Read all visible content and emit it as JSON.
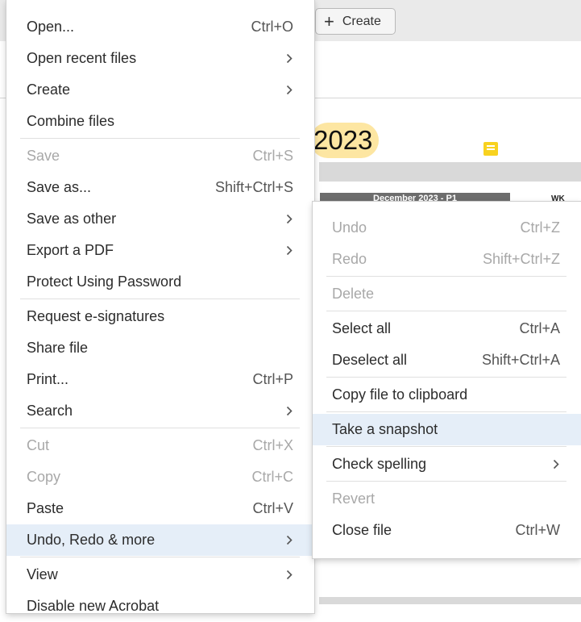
{
  "toolbar": {
    "create_label": "Create"
  },
  "document": {
    "year_text": "2023",
    "calendar_header": "December 2023 - P1",
    "wk_label": "WK"
  },
  "main_menu": {
    "items": [
      {
        "label": "Open...",
        "shortcut": "Ctrl+O"
      },
      {
        "label": "Open recent files",
        "submenu": true
      },
      {
        "label": "Create",
        "submenu": true
      },
      {
        "label": "Combine files"
      },
      {
        "label": "Save",
        "shortcut": "Ctrl+S",
        "disabled": true
      },
      {
        "label": "Save as...",
        "shortcut": "Shift+Ctrl+S"
      },
      {
        "label": "Save as other",
        "submenu": true
      },
      {
        "label": "Export a PDF",
        "submenu": true
      },
      {
        "label": "Protect Using Password"
      },
      {
        "label": "Request e-signatures"
      },
      {
        "label": "Share file"
      },
      {
        "label": "Print...",
        "shortcut": "Ctrl+P"
      },
      {
        "label": "Search",
        "submenu": true
      },
      {
        "label": "Cut",
        "shortcut": "Ctrl+X",
        "disabled": true
      },
      {
        "label": "Copy",
        "shortcut": "Ctrl+C",
        "disabled": true
      },
      {
        "label": "Paste",
        "shortcut": "Ctrl+V"
      },
      {
        "label": "Undo, Redo & more",
        "submenu": true,
        "highlighted": true
      },
      {
        "label": "View",
        "submenu": true
      },
      {
        "label": "Disable new Acrobat"
      }
    ]
  },
  "sub_menu": {
    "items": [
      {
        "label": "Undo",
        "shortcut": "Ctrl+Z",
        "disabled": true
      },
      {
        "label": "Redo",
        "shortcut": "Shift+Ctrl+Z",
        "disabled": true
      },
      {
        "label": "Delete",
        "disabled": true
      },
      {
        "label": "Select all",
        "shortcut": "Ctrl+A"
      },
      {
        "label": "Deselect all",
        "shortcut": "Shift+Ctrl+A"
      },
      {
        "label": "Copy file to clipboard"
      },
      {
        "label": "Take a snapshot",
        "highlighted": true
      },
      {
        "label": "Check spelling",
        "submenu": true
      },
      {
        "label": "Revert",
        "disabled": true
      },
      {
        "label": "Close file",
        "shortcut": "Ctrl+W"
      }
    ]
  },
  "colors": {
    "highlight": "#e5eef8",
    "disabled_text": "#a8a8a8",
    "year_highlight": "#fde6a2",
    "comment_icon": "#f8d21f"
  }
}
